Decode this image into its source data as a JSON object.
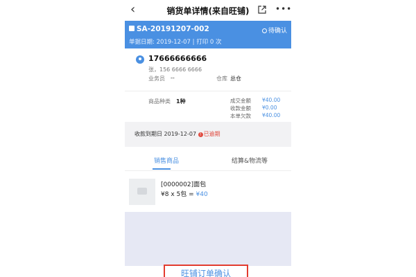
{
  "header": {
    "back_glyph": "‹",
    "title": "销货单详情(来自旺铺)",
    "more_glyph": "•••"
  },
  "order": {
    "number": "SA-20191207-002",
    "status": "待确认",
    "date_line": "单据日期: 2019-12-07 | 打印 0 次"
  },
  "customer": {
    "phone": "17666666666",
    "contact": "张，156 6666 6666",
    "salesman_label": "业务员",
    "salesman_value": "--",
    "warehouse_label": "仓库",
    "warehouse_value": "总仓"
  },
  "summary": {
    "kinds_label": "商品种类",
    "kinds_value": "1种",
    "amounts": [
      {
        "label": "成交金额",
        "value": "¥40.00"
      },
      {
        "label": "收款金额",
        "value": "¥0.00"
      },
      {
        "label": "本单欠款",
        "value": "¥40.00"
      }
    ]
  },
  "due": {
    "text": "收款到期日 2019-12-07",
    "overdue_icon": "!",
    "overdue_label": "已逾期"
  },
  "tabs": [
    {
      "label": "销售商品",
      "active": true
    },
    {
      "label": "结算&物流等",
      "active": false
    }
  ],
  "product": {
    "name": "[0000002]面包",
    "price_expr": "¥8 x 5包 = ",
    "total": "¥40"
  },
  "bottom": {
    "confirm_label": "旺铺订单确认"
  },
  "colors": {
    "accent": "#4a90e2",
    "danger": "#e04a3f",
    "highlight_border": "#e23b2e"
  },
  "icons": [
    "back-icon",
    "share-icon",
    "more-icon",
    "order-icon",
    "status-icon",
    "avatar-icon",
    "overdue-icon",
    "image-placeholder-icon"
  ]
}
